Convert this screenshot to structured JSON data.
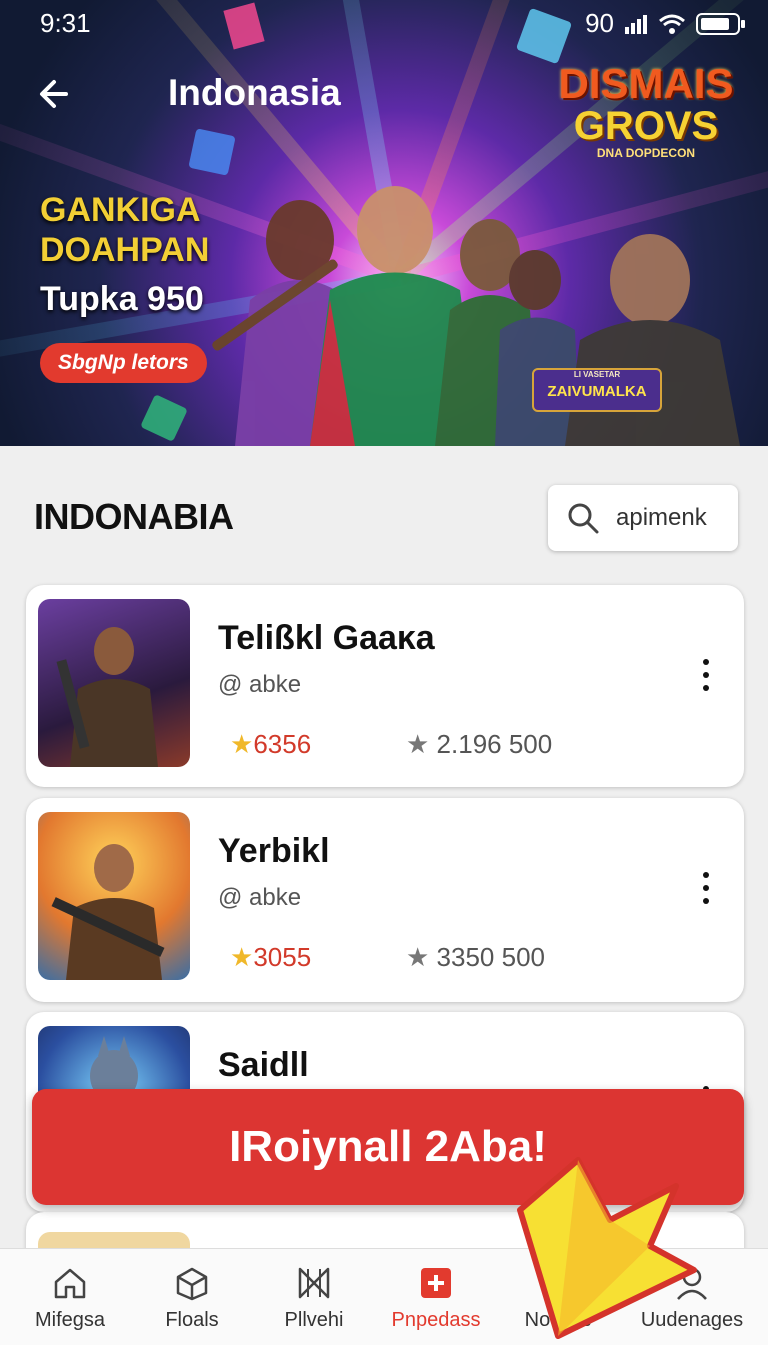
{
  "status_bar": {
    "time": "9:31",
    "right_text": "90"
  },
  "header": {
    "title": "Indonasia"
  },
  "banner": {
    "promo_line1": "GANKIGA",
    "promo_line2": "DOAHPAN",
    "promo_sub": "Tupka 950",
    "promo_button": "SbgNp letors",
    "logo_line1": "DISMAIS",
    "logo_line2": "GROVS",
    "logo_line3": "DNA DOPDECON",
    "badge_small": "LI VASETAR",
    "badge_text": "ZAIVUMALKA"
  },
  "section": {
    "title": "INDONABIA"
  },
  "search": {
    "placeholder": "apimenk"
  },
  "games": [
    {
      "title": "Telißkl Gaaĸa",
      "author": "@ abke",
      "rating": "6356",
      "count": "2.196 500"
    },
    {
      "title": "Yerbikl",
      "author": "@ abke",
      "rating": "3055",
      "count": "3350 500"
    },
    {
      "title": "Saidll"
    }
  ],
  "cta": {
    "label": "IRoiynall 2Aba!"
  },
  "bottom_nav": [
    {
      "label": "Mifegsa",
      "icon": "home-icon"
    },
    {
      "label": "Floals",
      "icon": "package-icon"
    },
    {
      "label": "Pllvehi",
      "icon": "bowtie-icon"
    },
    {
      "label": "Pnpedass",
      "icon": "first-aid-icon",
      "active": true
    },
    {
      "label": "Notifigs",
      "icon": "cat-icon"
    },
    {
      "label": "Uudenages",
      "icon": "user-icon"
    }
  ],
  "colors": {
    "accent": "#e23a2e",
    "gold": "#f2cf35",
    "banner_dark": "#111a33"
  }
}
